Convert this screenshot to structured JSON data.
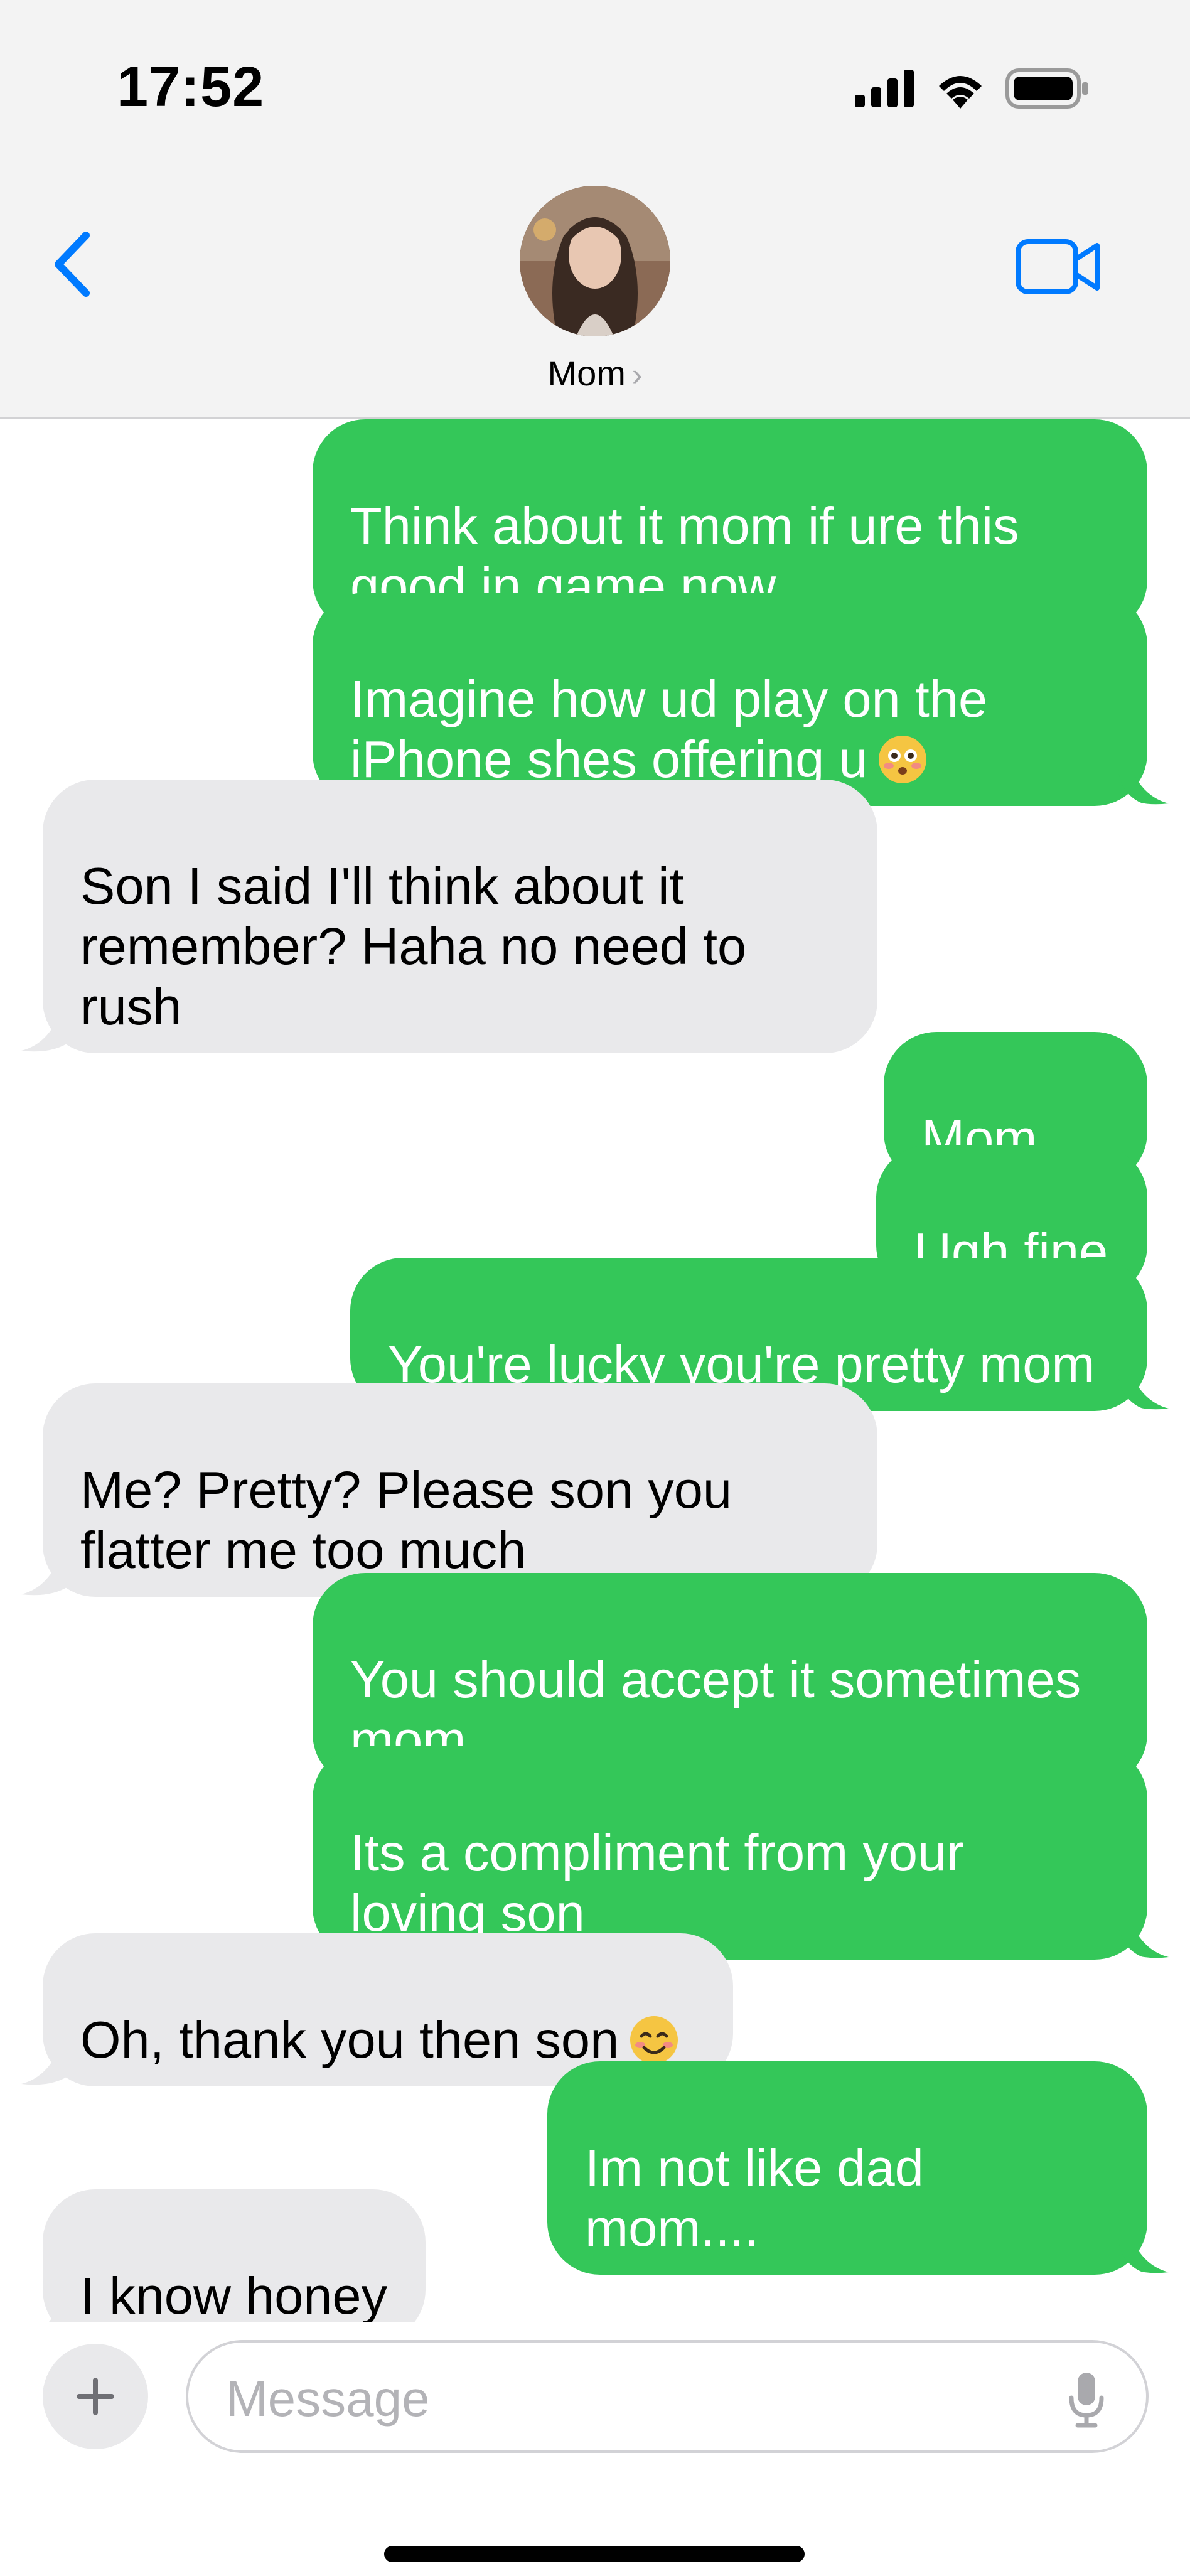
{
  "status_bar": {
    "time": "17:52"
  },
  "header": {
    "contact_name": "Mom"
  },
  "messages": [
    {
      "from": "me",
      "text": "Think about it mom if ure this\ngood in game now"
    },
    {
      "from": "me",
      "text": "Imagine how ud play on the\niPhone shes offering u",
      "emoji": "flushed-face"
    },
    {
      "from": "mom",
      "text": "Son I said I'll think about it\nremember? Haha no need to\nrush"
    },
    {
      "from": "me",
      "text": "Mom....."
    },
    {
      "from": "me",
      "text": "Ugh fine"
    },
    {
      "from": "me",
      "text": "You're lucky you're pretty mom"
    },
    {
      "from": "mom",
      "text": "Me? Pretty? Please son you\nflatter me too much"
    },
    {
      "from": "me",
      "text": "You should accept it sometimes\nmom"
    },
    {
      "from": "me",
      "text": "Its a compliment from your\nloving son"
    },
    {
      "from": "mom",
      "text": "Oh, thank you then son",
      "emoji": "smiling-face"
    },
    {
      "from": "me",
      "text": "Im not like dad mom...."
    },
    {
      "from": "mom",
      "text": "I know honey"
    }
  ],
  "input": {
    "placeholder": "Message",
    "value": ""
  },
  "colors": {
    "sent_bubble": "#34c759",
    "received_bubble": "#e9e9eb",
    "accent": "#007aff"
  },
  "icons": [
    "signal-icon",
    "wifi-icon",
    "battery-icon",
    "back-chevron-icon",
    "video-camera-icon",
    "plus-icon",
    "microphone-icon"
  ]
}
